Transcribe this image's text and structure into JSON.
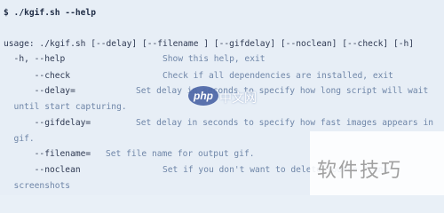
{
  "terminal": {
    "prompt_line": "$ ./kgif.sh --help",
    "usage_line": "usage: ./kgif.sh [--delay] [--filename ] [--gifdelay] [--noclean] [--check] [-h]",
    "options": [
      {
        "left": "  -h, --help",
        "desc": "Show this help, exit"
      },
      {
        "left": "      --check",
        "desc": "Check if all dependencies are installed, exit"
      },
      {
        "left": "      --delay=",
        "desc": "Set delay in seconds to specify how long script will wait"
      },
      {
        "left": "  until start capturing.",
        "desc": ""
      },
      {
        "left": "      --gifdelay=",
        "desc": "Set delay in seconds to specify how fast images appears in"
      },
      {
        "left": "  gif.",
        "desc": ""
      },
      {
        "left": "      --filename=",
        "desc": "Set file name for output gif."
      },
      {
        "left": "      --noclean",
        "desc": "Set if you don't want to delete source *.png"
      },
      {
        "left": "  screenshots",
        "desc": ""
      }
    ]
  },
  "watermark": {
    "php_badge": "php",
    "php_cn": "中文网",
    "site_cn": "软件技巧"
  }
}
